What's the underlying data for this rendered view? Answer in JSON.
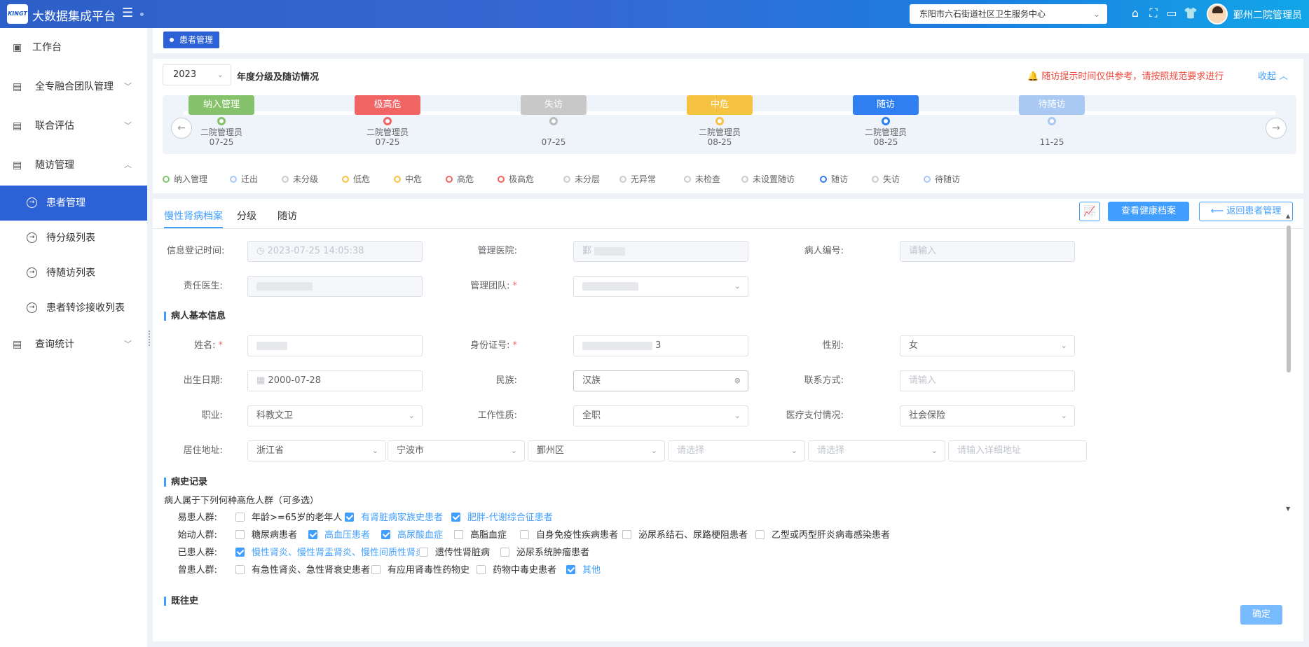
{
  "app": {
    "logo_text": "KINGT",
    "title": "大数据集成平台"
  },
  "header": {
    "org_select": "东阳市六石街道社区卫生服务中心",
    "icons": [
      "home-icon",
      "fullscreen-icon",
      "chart-icon",
      "shirt-icon"
    ],
    "username": "鄞州二院管理员"
  },
  "sidebar": {
    "items": [
      {
        "label": "工作台",
        "icon": "terminal-icon"
      },
      {
        "label": "全专融合团队管理",
        "icon": "doc-icon"
      },
      {
        "label": "联合评估",
        "icon": "doc-icon"
      },
      {
        "label": "随访管理",
        "icon": "doc-icon"
      }
    ],
    "sub_items": [
      "患者管理",
      "待分级列表",
      "待随访列表",
      "患者转诊接收列表"
    ],
    "last_item": "查询统计"
  },
  "tagbar": {
    "tag": "患者管理"
  },
  "overview": {
    "year": "2023",
    "title": "年度分级及随访情况",
    "warning": "随访提示时间仅供参考，请按照规范要求进行",
    "collapse": "收起",
    "timeline": [
      {
        "label": "纳入管理",
        "by": "二院管理员",
        "date": "07-25",
        "color": "#85c26b",
        "dot": "#85c26b"
      },
      {
        "label": "极高危",
        "by": "二院管理员",
        "date": "07-25",
        "color": "#f06464",
        "dot": "#f06464"
      },
      {
        "label": "失访",
        "by": "",
        "date": "07-25",
        "color": "#c8c8c8",
        "dot": "#bbbbbb"
      },
      {
        "label": "中危",
        "by": "二院管理员",
        "date": "08-25",
        "color": "#f5c242",
        "dot": "#f5c242"
      },
      {
        "label": "随访",
        "by": "二院管理员",
        "date": "08-25",
        "color": "#2f7ff0",
        "dot": "#2f7ff0"
      },
      {
        "label": "待随访",
        "by": "",
        "date": "11-25",
        "color": "#a9c9f2",
        "dot": "#a9c9f2"
      }
    ],
    "legend": [
      {
        "label": "纳入管理",
        "color": "#85c26b"
      },
      {
        "label": "迁出",
        "color": "#a9c9f2"
      },
      {
        "label": "未分级",
        "color": "#cccccc"
      },
      {
        "label": "低危",
        "color": "#f5c242"
      },
      {
        "label": "中危",
        "color": "#f5c242"
      },
      {
        "label": "高危",
        "color": "#f06464"
      },
      {
        "label": "极高危",
        "color": "#f06464"
      },
      {
        "label": "未分层",
        "color": "#cccccc"
      },
      {
        "label": "无异常",
        "color": "#cccccc"
      },
      {
        "label": "未检查",
        "color": "#cccccc"
      },
      {
        "label": "未设置随访",
        "color": "#cccccc"
      },
      {
        "label": "随访",
        "color": "#2f7ff0"
      },
      {
        "label": "失访",
        "color": "#cccccc"
      },
      {
        "label": "待随访",
        "color": "#a9c9f2"
      }
    ]
  },
  "record": {
    "tabs": [
      "慢性肾病档案",
      "分级",
      "随访"
    ],
    "buttons": {
      "health": "查看健康档案",
      "back": "返回患者管理"
    },
    "fields": {
      "reg_time_label": "信息登记时间:",
      "reg_time": "2023-07-25 14:05:38",
      "hospital_label": "管理医院:",
      "hospital": "鄞",
      "patient_no_label": "病人编号:",
      "patient_no_ph": "请输入",
      "doctor_label": "责任医生:",
      "team_label": "管理团队:"
    },
    "basic_section": "病人基本信息",
    "basic": {
      "name_label": "姓名:",
      "id_label": "身份证号:",
      "id_tail": "3",
      "gender_label": "性别:",
      "gender": "女",
      "birth_label": "出生日期:",
      "birth": "2000-07-28",
      "ethnic_label": "民族:",
      "ethnic": "汉族",
      "contact_label": "联系方式:",
      "contact_ph": "请输入",
      "job_label": "职业:",
      "job": "科教文卫",
      "work_label": "工作性质:",
      "work": "全职",
      "pay_label": "医疗支付情况:",
      "pay": "社会保险",
      "addr_label": "居住地址:",
      "province": "浙江省",
      "city": "宁波市",
      "district": "鄞州区",
      "select_ph": "请选择",
      "addr_ph": "请输入详细地址"
    },
    "history_section": "病史记录",
    "history_subtitle": "病人属于下列何种高危人群（可多选）",
    "groups": [
      {
        "label": "易患人群:",
        "options": [
          {
            "text": "年龄>=65岁的老年人",
            "checked": false
          },
          {
            "text": "有肾脏病家族史患者",
            "checked": true
          },
          {
            "text": "肥胖-代谢综合征患者",
            "checked": true
          }
        ]
      },
      {
        "label": "始动人群:",
        "options": [
          {
            "text": "糖尿病患者",
            "checked": false
          },
          {
            "text": "高血压患者",
            "checked": true
          },
          {
            "text": "高尿酸血症",
            "checked": true
          },
          {
            "text": "高脂血症",
            "checked": false
          },
          {
            "text": "自身免疫性疾病患者",
            "checked": false
          },
          {
            "text": "泌尿系结石、尿路梗阻患者",
            "checked": false
          },
          {
            "text": "乙型或丙型肝炎病毒感染患者",
            "checked": false
          }
        ]
      },
      {
        "label": "已患人群:",
        "options": [
          {
            "text": "慢性肾炎、慢性肾盂肾炎、慢性间质性肾炎",
            "checked": true
          },
          {
            "text": "遗传性肾脏病",
            "checked": false
          },
          {
            "text": "泌尿系统肿瘤患者",
            "checked": false
          }
        ]
      },
      {
        "label": "曾患人群:",
        "options": [
          {
            "text": "有急性肾炎、急性肾衰史患者",
            "checked": false
          },
          {
            "text": "有应用肾毒性药物史",
            "checked": false
          },
          {
            "text": "药物中毒史患者",
            "checked": false
          },
          {
            "text": "其他",
            "checked": true
          }
        ]
      }
    ],
    "past_section": "既往史",
    "confirm": "确定"
  }
}
